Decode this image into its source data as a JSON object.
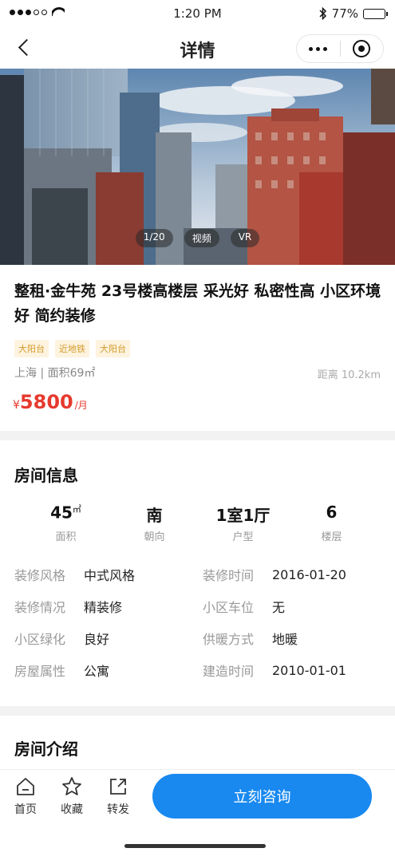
{
  "status_bar": {
    "time": "1:20 PM",
    "battery": "77%",
    "battery_level": 0.77
  },
  "nav": {
    "title": "详情",
    "icons": [
      "back-icon",
      "more-icon",
      "target-icon"
    ]
  },
  "gallery": {
    "tabs": [
      "1/20",
      "视频",
      "VR"
    ]
  },
  "listing": {
    "title": "整租·金牛苑 23号楼高楼层 采光好 私密性高 小区环境好 简约装修",
    "tags": [
      "大阳台",
      "近地铁",
      "大阳台"
    ],
    "location": "上海 | 面积69㎡",
    "distance": "距离 10.2km",
    "price": {
      "currency": "¥",
      "value": "5800",
      "unit": "/月"
    },
    "colors": {
      "price": "#e63a2e",
      "tag_text": "#d49a2a",
      "tag_bg": "#fdf3df"
    }
  },
  "room_info": {
    "title": "房间信息",
    "stats": [
      {
        "value": "45",
        "unit": "㎡",
        "label": "面积"
      },
      {
        "value": "南",
        "unit": "",
        "label": "朝向"
      },
      {
        "value": "1室1厅",
        "unit": "",
        "label": "户型"
      },
      {
        "value": "6",
        "unit": "",
        "label": "楼层"
      }
    ],
    "details": [
      {
        "label": "装修风格",
        "value": "中式风格"
      },
      {
        "label": "装修时间",
        "value": "2016-01-20"
      },
      {
        "label": "装修情况",
        "value": "精装修"
      },
      {
        "label": "小区车位",
        "value": "无"
      },
      {
        "label": "小区绿化",
        "value": "良好"
      },
      {
        "label": "供暖方式",
        "value": "地暖"
      },
      {
        "label": "房屋属性",
        "value": "公寓"
      },
      {
        "label": "建造时间",
        "value": "2010-01-01"
      }
    ]
  },
  "intro": {
    "title": "房间介绍"
  },
  "bottom_bar": {
    "actions": [
      {
        "label": "首页",
        "icon": "home-icon"
      },
      {
        "label": "收藏",
        "icon": "star-icon"
      },
      {
        "label": "转发",
        "icon": "share-icon"
      }
    ],
    "consult_label": "立刻咨询",
    "accent": "#1989f0"
  }
}
